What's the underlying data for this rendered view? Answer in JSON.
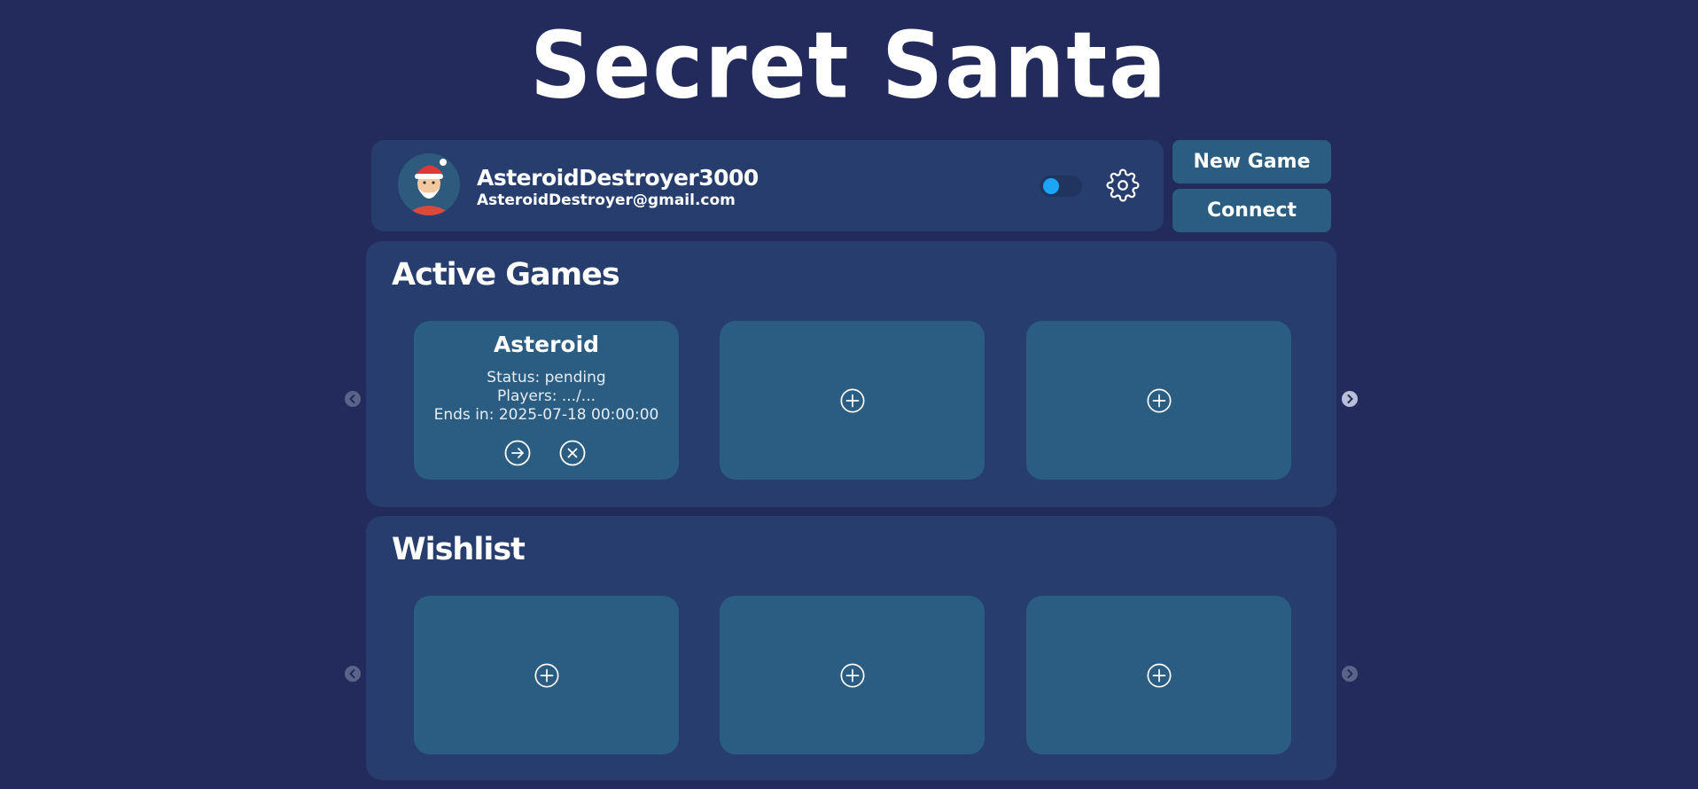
{
  "app": {
    "title": "Secret Santa"
  },
  "profile": {
    "username": "AsteroidDestroyer3000",
    "email": "AsteroidDestroyer@gmail.com",
    "avatar_icon": "santa-avatar-icon",
    "toggle_on": true,
    "settings_icon": "gear-icon"
  },
  "actions": {
    "new_game_label": "New Game",
    "connect_label": "Connect"
  },
  "active_games": {
    "title": "Active Games",
    "games": [
      {
        "name": "Asteroid",
        "status": "Status: pending",
        "players": "Players: .../...",
        "ends": "Ends in: 2025-07-18 00:00:00",
        "open_icon": "arrow-right-circle-icon",
        "remove_icon": "close-circle-icon"
      }
    ],
    "empty_slots": 2,
    "add_icon": "plus-circle-icon"
  },
  "wishlist": {
    "title": "Wishlist",
    "empty_slots": 3,
    "add_icon": "plus-circle-icon"
  },
  "colors": {
    "background": "#232a5c",
    "panel": "#263d6e",
    "card": "#2b5d82",
    "toggle_accent": "#1ba6f5"
  }
}
